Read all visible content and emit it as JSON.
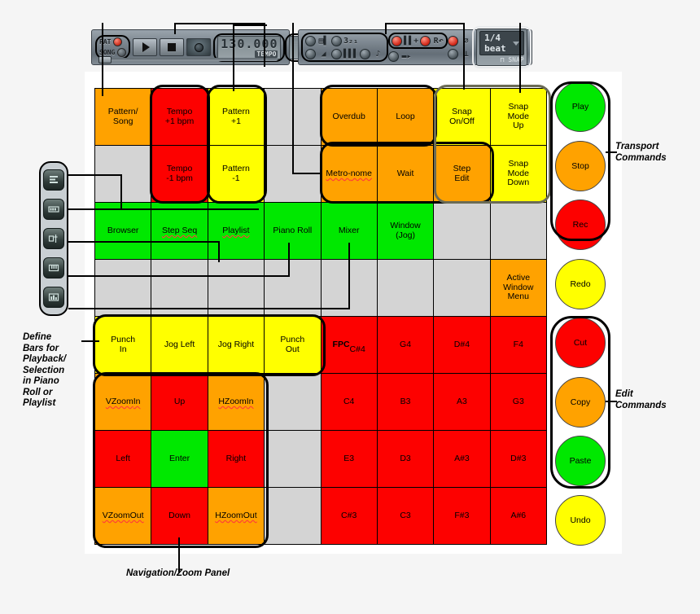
{
  "toolbars": {
    "transport": {
      "name": "transport-toolbar",
      "pat_label": "PAT",
      "song_label": "SONG",
      "play_icon": "play-icon",
      "stop_icon": "stop-icon",
      "record_icon": "record-icon",
      "tempo_value": "130.000",
      "tempo_tag": "TEMPO",
      "pattern_value": "",
      "pattern_tag": "PAT"
    },
    "record": {
      "name": "record-options-toolbar",
      "typing_icon": "typing-keyboard-icon",
      "multilink_icon": "multilink-icon",
      "step_icon": "step-321-icon",
      "overdub_icon": "overdub-icon",
      "loop_icon": "loop-record-icon",
      "metronome_icon": "metronome-icon",
      "wait_icon": "wait-icon",
      "countdown_icon": "countdown-icon",
      "blend_icon": "blend-notes-icon",
      "stepedit_icon": "step-edit-icon",
      "autoscroll_icon": "autoscroll-icon",
      "snap_value": "1/4 beat",
      "snap_tag": "SNAP"
    }
  },
  "left_strip": {
    "name": "window-shortcut-strip",
    "items": [
      {
        "icon": "playlist-icon",
        "label": "Playlist"
      },
      {
        "icon": "step-seq-icon",
        "label": "Step Sequencer"
      },
      {
        "icon": "mixer-icon",
        "label": "Mixer"
      },
      {
        "icon": "piano-roll-icon",
        "label": "Piano Roll"
      },
      {
        "icon": "browser-icon",
        "label": "Browser"
      }
    ]
  },
  "grid": {
    "columns": 8,
    "rows": 8,
    "cells": [
      [
        {
          "label": "Pattern/\nSong",
          "color": "orange"
        },
        {
          "label": "Tempo\n+1 bpm",
          "color": "red"
        },
        {
          "label": "Pattern\n+1",
          "color": "yellow"
        },
        {
          "label": "",
          "color": "grey"
        },
        {
          "label": "Overdub",
          "color": "orange"
        },
        {
          "label": "Loop",
          "color": "orange"
        },
        {
          "label": "Snap\nOn/Off",
          "color": "yellow"
        },
        {
          "label": "Snap\nMode\nUp",
          "color": "yellow"
        }
      ],
      [
        {
          "label": "",
          "color": "grey"
        },
        {
          "label": "Tempo\n-1 bpm",
          "color": "red"
        },
        {
          "label": "Pattern\n-1",
          "color": "yellow"
        },
        {
          "label": "",
          "color": "grey"
        },
        {
          "label": "Metro-\nnome",
          "color": "orange",
          "wavy": true
        },
        {
          "label": "Wait",
          "color": "orange"
        },
        {
          "label": "Step\nEdit",
          "color": "orange"
        },
        {
          "label": "Snap\nMode\nDown",
          "color": "yellow"
        }
      ],
      [
        {
          "label": "Browser",
          "color": "green"
        },
        {
          "label": "Step Seq",
          "color": "green",
          "wavy": true
        },
        {
          "label": "Playlist",
          "color": "green",
          "wavy": true
        },
        {
          "label": "Piano Roll",
          "color": "green"
        },
        {
          "label": "Mixer",
          "color": "green"
        },
        {
          "label": "Window\n(Jog)",
          "color": "green"
        },
        {
          "label": "",
          "color": "grey"
        },
        {
          "label": "",
          "color": "grey"
        }
      ],
      [
        {
          "label": "",
          "color": "grey"
        },
        {
          "label": "",
          "color": "grey"
        },
        {
          "label": "",
          "color": "grey"
        },
        {
          "label": "",
          "color": "grey"
        },
        {
          "label": "",
          "color": "grey"
        },
        {
          "label": "",
          "color": "grey"
        },
        {
          "label": "",
          "color": "grey"
        },
        {
          "label": "Active\nWindow\nMenu",
          "color": "orange"
        }
      ],
      [
        {
          "label": "Punch\nIn",
          "color": "yellow"
        },
        {
          "label": "Jog Left",
          "color": "yellow"
        },
        {
          "label": "Jog Right",
          "color": "yellow"
        },
        {
          "label": "Punch\nOut",
          "color": "yellow"
        },
        {
          "label": "FPC\nC#4",
          "color": "red",
          "bold_first": true
        },
        {
          "label": "G4",
          "color": "red"
        },
        {
          "label": "D#4",
          "color": "red"
        },
        {
          "label": "F4",
          "color": "red"
        }
      ],
      [
        {
          "label": "VZoom\nIn",
          "color": "orange",
          "wavy": true
        },
        {
          "label": "Up",
          "color": "red"
        },
        {
          "label": "HZoom\nIn",
          "color": "orange",
          "wavy": true
        },
        {
          "label": "",
          "color": "grey"
        },
        {
          "label": "C4",
          "color": "red"
        },
        {
          "label": "B3",
          "color": "red"
        },
        {
          "label": "A3",
          "color": "red"
        },
        {
          "label": "G3",
          "color": "red"
        }
      ],
      [
        {
          "label": "Left",
          "color": "red"
        },
        {
          "label": "Enter",
          "color": "green"
        },
        {
          "label": "Right",
          "color": "red"
        },
        {
          "label": "",
          "color": "grey"
        },
        {
          "label": "E3",
          "color": "red"
        },
        {
          "label": "D3",
          "color": "red"
        },
        {
          "label": "A#3",
          "color": "red"
        },
        {
          "label": "D#3",
          "color": "red"
        }
      ],
      [
        {
          "label": "VZoom\nOut",
          "color": "orange",
          "wavy": true
        },
        {
          "label": "Down",
          "color": "red"
        },
        {
          "label": "HZoom\nOut",
          "color": "orange",
          "wavy": true
        },
        {
          "label": "",
          "color": "grey"
        },
        {
          "label": "C#3",
          "color": "red"
        },
        {
          "label": "C3",
          "color": "red"
        },
        {
          "label": "F#3",
          "color": "red"
        },
        {
          "label": "A#6",
          "color": "red"
        }
      ]
    ]
  },
  "right_buttons": [
    {
      "label": "Play",
      "color": "green"
    },
    {
      "label": "Stop",
      "color": "orange"
    },
    {
      "label": "Rec",
      "color": "red"
    },
    {
      "label": "Redo",
      "color": "yellow"
    },
    {
      "label": "Cut",
      "color": "red"
    },
    {
      "label": "Copy",
      "color": "orange"
    },
    {
      "label": "Paste",
      "color": "green"
    },
    {
      "label": "Undo",
      "color": "yellow"
    }
  ],
  "annotations": {
    "transport_commands": "Transport\nCommands",
    "edit_commands": "Edit\nCommands",
    "define_bars": "Define\nBars for\nPlayback/\nSelection\nin Piano\nRoll or\nPlaylist",
    "navigation_zoom": "Navigation/Zoom Panel"
  },
  "colors": {
    "orange": "#ffa200",
    "red": "#fd0100",
    "yellow": "#ffff00",
    "green": "#00e800",
    "grey": "#d4d4d4",
    "outline": "#000000",
    "panel": "#ffffff",
    "background": "#f5f5f5"
  }
}
